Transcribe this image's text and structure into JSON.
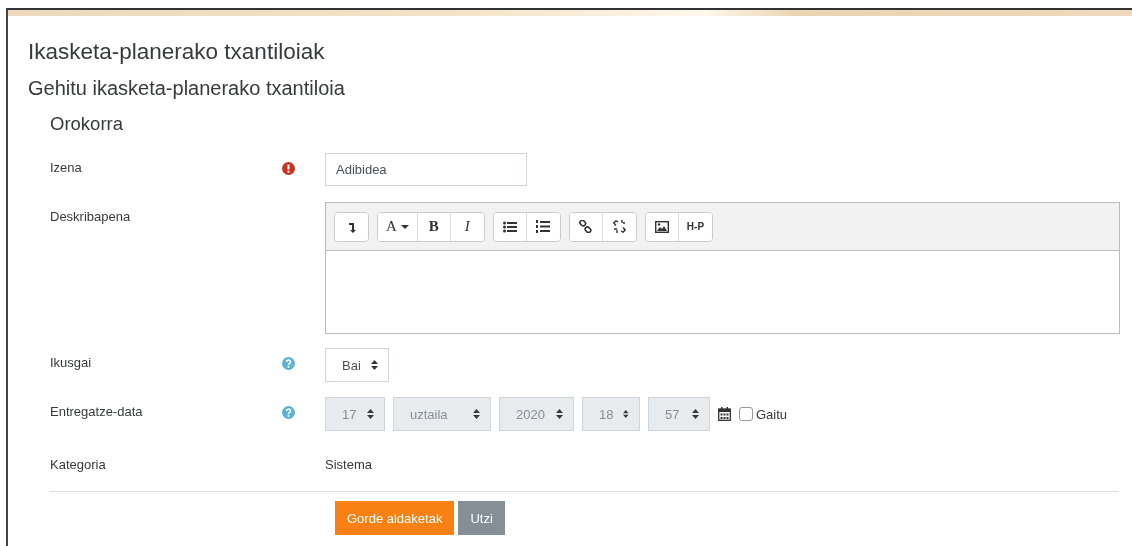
{
  "page_title": "Ikasketa-planerako txantiloiak",
  "form_title": "Gehitu ikasketa-planerako txantiloia",
  "section": "Orokorra",
  "fields": [
    {
      "kind": "text",
      "label": "Izena",
      "required": true,
      "value": "Adibidea"
    },
    {
      "kind": "editor",
      "label": "Deskribapena",
      "toolbar": [
        [
          {
            "kind": "collapse"
          }
        ],
        [
          {
            "kind": "letter",
            "label": "A",
            "dropdown": true
          },
          {
            "kind": "bold-letter",
            "label": "B"
          },
          {
            "kind": "italic-letter",
            "label": "I"
          }
        ],
        [
          {
            "kind": "bullets"
          },
          {
            "kind": "numbers"
          }
        ],
        [
          {
            "kind": "link"
          },
          {
            "kind": "unlink"
          }
        ],
        [
          {
            "kind": "image"
          },
          {
            "kind": "letter",
            "label": "H-P",
            "dropdown": false
          }
        ]
      ]
    },
    {
      "kind": "select",
      "label": "Ikusgai",
      "help": true,
      "value": "Bai"
    },
    {
      "kind": "date",
      "label": "Entregatze-data",
      "help": true,
      "parts": [
        {
          "value": "17",
          "disabled": true
        },
        {
          "value": "uztaila",
          "disabled": true
        },
        {
          "value": "2020",
          "disabled": true
        },
        {
          "value": "18",
          "disabled": true
        },
        {
          "value": "57",
          "disabled": true
        }
      ],
      "enable_label": "Gaitu",
      "enabled": false
    },
    {
      "kind": "static",
      "label": "Kategoria",
      "value": "Sistema"
    }
  ],
  "buttons": [
    {
      "label": "Gorde aldaketak",
      "kind": "primary"
    },
    {
      "label": "Utzi",
      "kind": "secondary"
    }
  ]
}
